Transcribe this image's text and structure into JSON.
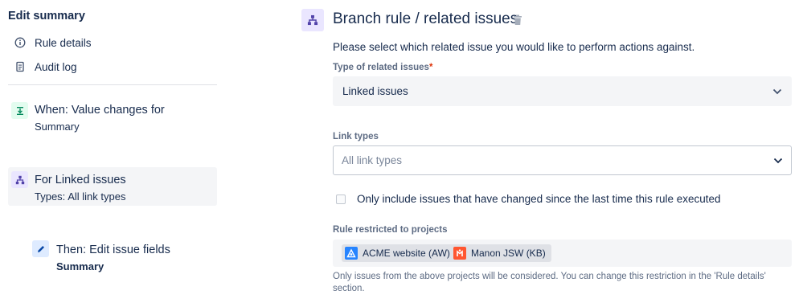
{
  "sidebar": {
    "title": "Edit summary",
    "links": [
      {
        "label": "Rule details",
        "icon": "info-icon"
      },
      {
        "label": "Audit log",
        "icon": "document-icon"
      }
    ],
    "components": [
      {
        "title": "When: Value changes for",
        "subtitle": "Summary",
        "icon": "trigger-icon",
        "selected": false
      },
      {
        "title": "For Linked issues",
        "subtitle": "Types: All link types",
        "icon": "branch-icon",
        "selected": true
      },
      {
        "title": "Then: Edit issue fields",
        "subtitle": "Summary",
        "icon": "pencil-icon",
        "selected": false
      }
    ]
  },
  "main": {
    "title": "Branch rule / related issues",
    "intro": "Please select which related issue you would like to perform actions against.",
    "type_field": {
      "label": "Type of related issues",
      "required_mark": "*",
      "value": "Linked issues"
    },
    "link_types_field": {
      "label": "Link types",
      "placeholder": "All link types"
    },
    "checkbox": {
      "label": "Only include issues that have changed since the last time this rule executed",
      "checked": false
    },
    "projects_field": {
      "label": "Rule restricted to projects",
      "projects": [
        {
          "name": "ACME website (AW)",
          "icon": "project-avatar-icon",
          "color": "#2684ff"
        },
        {
          "name": "Manon JSW (KB)",
          "icon": "project-avatar-icon",
          "color": "#ff5630"
        }
      ],
      "help": "Only issues from the above projects will be considered. You can change this restriction in the 'Rule details' section."
    }
  },
  "colors": {
    "trigger_bg": "#e3fcef",
    "trigger_fg": "#00875a",
    "branch_bg": "#eae6ff",
    "branch_fg": "#5243aa",
    "action_bg": "#deebff",
    "action_fg": "#0747a6",
    "selected_bg": "#f4f5f7",
    "required": "#de350b"
  }
}
